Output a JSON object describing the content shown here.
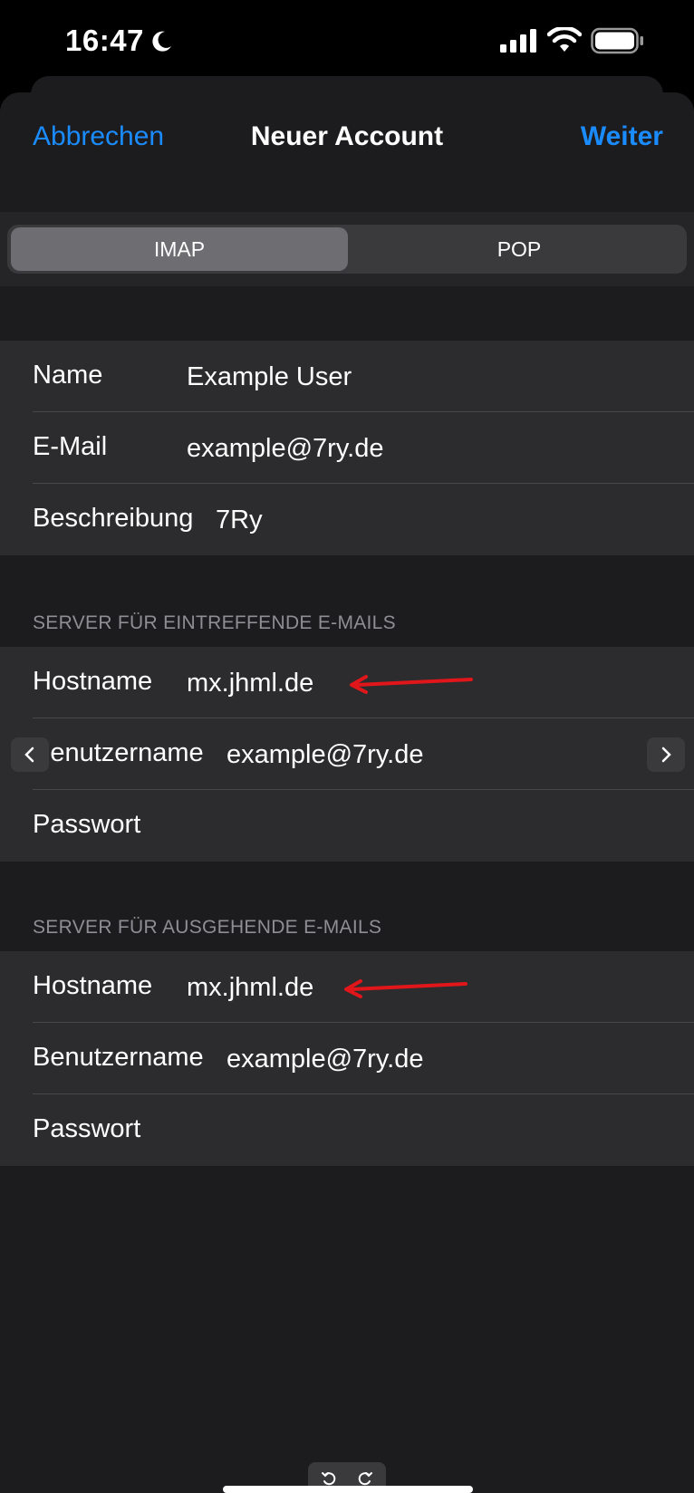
{
  "status_bar": {
    "time": "16:47"
  },
  "nav": {
    "cancel_label": "Abbrechen",
    "title": "Neuer Account",
    "next_label": "Weiter"
  },
  "segments": {
    "imap_label": "IMAP",
    "pop_label": "POP",
    "selected": "IMAP"
  },
  "account": {
    "name_label": "Name",
    "name_value": "Example User",
    "email_label": "E-Mail",
    "email_value": "example@7ry.de",
    "description_label": "Beschreibung",
    "description_value": "7Ry"
  },
  "incoming": {
    "header": "SERVER FÜR EINTREFFENDE E-MAILS",
    "hostname_label": "Hostname",
    "hostname_value": "mx.jhml.de",
    "username_label": "Benutzername",
    "username_value": "example@7ry.de",
    "password_label": "Passwort",
    "password_value": ""
  },
  "outgoing": {
    "header": "SERVER FÜR AUSGEHENDE E-MAILS",
    "hostname_label": "Hostname",
    "hostname_value": "mx.jhml.de",
    "username_label": "Benutzername",
    "username_value": "example@7ry.de",
    "password_label": "Passwort",
    "password_value": ""
  },
  "colors": {
    "accent": "#1a8cff",
    "annotation_arrow": "#e0161b",
    "background": "#1c1c1e",
    "cell": "#2c2c2e"
  },
  "icons": {
    "moon": "moon-icon",
    "signal": "cellular-signal-icon",
    "wifi": "wifi-icon",
    "battery": "battery-icon",
    "prev": "chevron-left-icon",
    "next": "chevron-right-icon",
    "undo": "undo-icon",
    "redo": "redo-icon"
  }
}
